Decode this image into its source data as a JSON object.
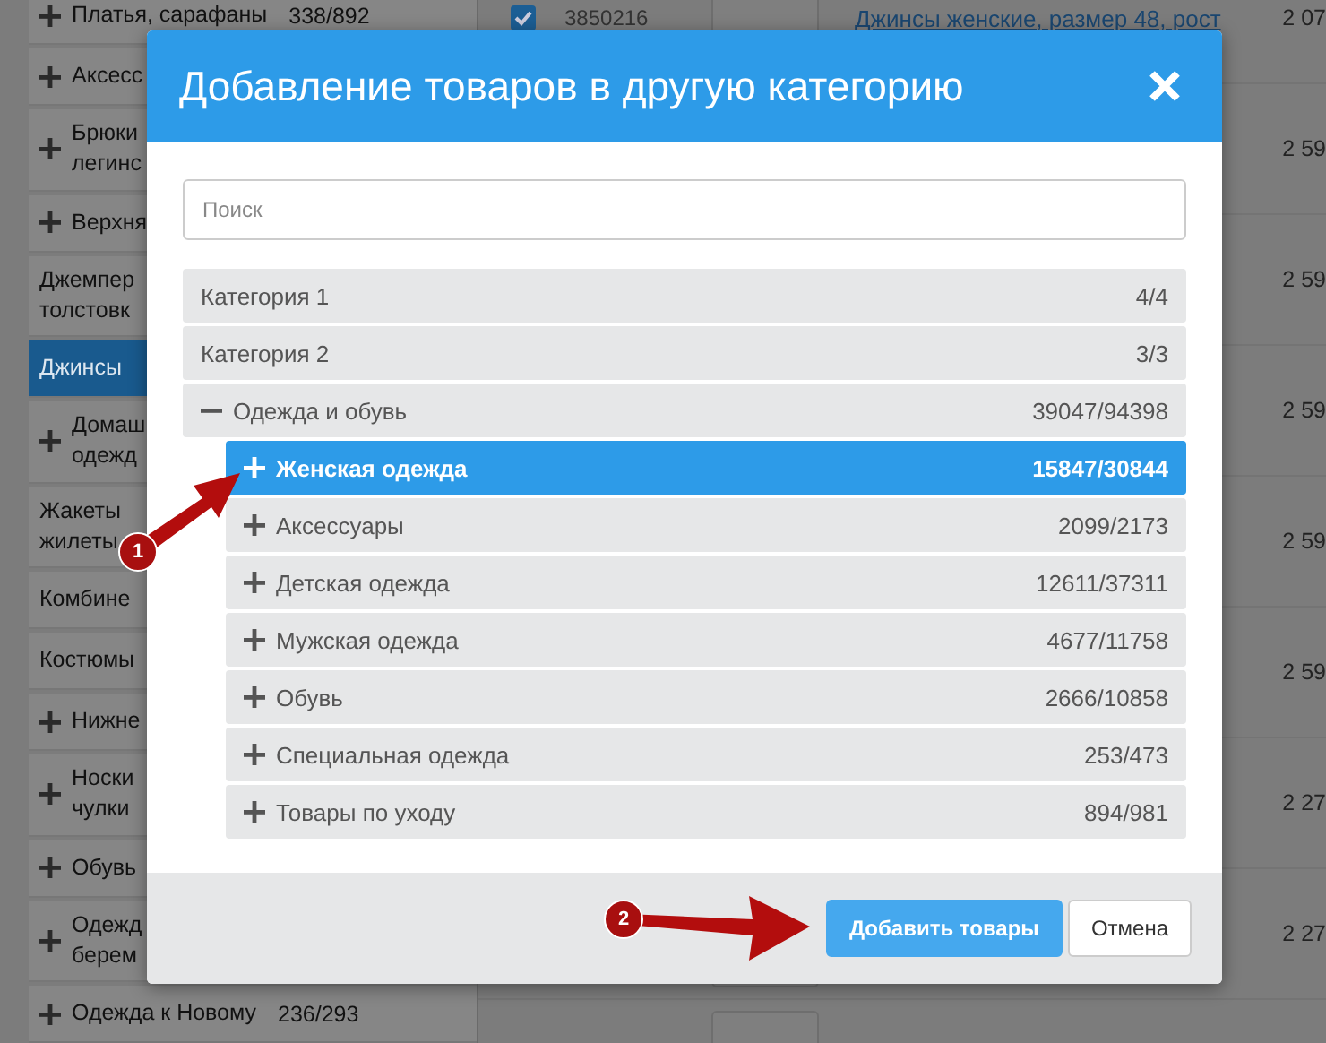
{
  "sidebar": {
    "items": [
      {
        "label": "Платья, сарафаны",
        "count": "338/892",
        "expandable": true,
        "selected": false
      },
      {
        "label": "Аксесс",
        "expandable": true,
        "selected": false
      },
      {
        "label": "Брюки\nлегинс",
        "expandable": true,
        "selected": false
      },
      {
        "label": "Верхня",
        "expandable": true,
        "selected": false
      },
      {
        "label": "Джемпер\nтолстовк",
        "expandable": false,
        "selected": false
      },
      {
        "label": "Джинсы",
        "expandable": false,
        "selected": true
      },
      {
        "label": "Домаш\nодежд",
        "expandable": true,
        "selected": false
      },
      {
        "label": "Жакеты\nжилеты",
        "expandable": false,
        "selected": false
      },
      {
        "label": "Комбине",
        "expandable": false,
        "selected": false
      },
      {
        "label": "Костюмы",
        "expandable": false,
        "selected": false
      },
      {
        "label": "Нижне",
        "expandable": true,
        "selected": false
      },
      {
        "label": "Носки\nчулки",
        "expandable": true,
        "selected": false
      },
      {
        "label": "Обувь",
        "expandable": true,
        "selected": false
      },
      {
        "label": "Одежд\nберем",
        "expandable": true,
        "selected": false
      },
      {
        "label": "Одежда к Новому",
        "count": "236/293",
        "expandable": true,
        "selected": false
      }
    ]
  },
  "table": {
    "rows": [
      {
        "checked": true,
        "id": "3850216",
        "title": "Джинсы женские, размер 48, рост",
        "price": "2 07"
      },
      {
        "price": "2 59"
      },
      {
        "price": "2 59"
      },
      {
        "price": "2 59"
      },
      {
        "price": "2 59"
      },
      {
        "price": "2 59"
      },
      {
        "price": "2 27"
      },
      {
        "price": "2 27"
      },
      {}
    ]
  },
  "dialog": {
    "title": "Добавление товаров в другую категорию",
    "search": {
      "placeholder": "Поиск"
    },
    "tree": [
      {
        "label": "Категория 1",
        "count": "4/4",
        "selected": false
      },
      {
        "label": "Категория 2",
        "count": "3/3",
        "selected": false
      },
      {
        "label": "Одежда и обувь",
        "count": "39047/94398",
        "selected": false,
        "expanded": true,
        "children": [
          {
            "label": "Женская одежда",
            "count": "15847/30844",
            "selected": true,
            "expanded": false
          },
          {
            "label": "Аксессуары",
            "count": "2099/2173",
            "selected": false,
            "expanded": false
          },
          {
            "label": "Детская одежда",
            "count": "12611/37311",
            "selected": false,
            "expanded": false
          },
          {
            "label": "Мужская одежда",
            "count": "4677/11758",
            "selected": false,
            "expanded": false
          },
          {
            "label": "Обувь",
            "count": "2666/10858",
            "selected": false,
            "expanded": false
          },
          {
            "label": "Специальная одежда",
            "count": "253/473",
            "selected": false,
            "expanded": false
          },
          {
            "label": "Товары по уходу",
            "count": "894/981",
            "selected": false,
            "expanded": false
          }
        ]
      }
    ],
    "buttons": [
      {
        "label": "Добавить товары",
        "kind": "primary"
      },
      {
        "label": "Отмена",
        "kind": "secondary"
      }
    ]
  },
  "callouts": [
    {
      "label": "1"
    },
    {
      "label": "2"
    }
  ]
}
